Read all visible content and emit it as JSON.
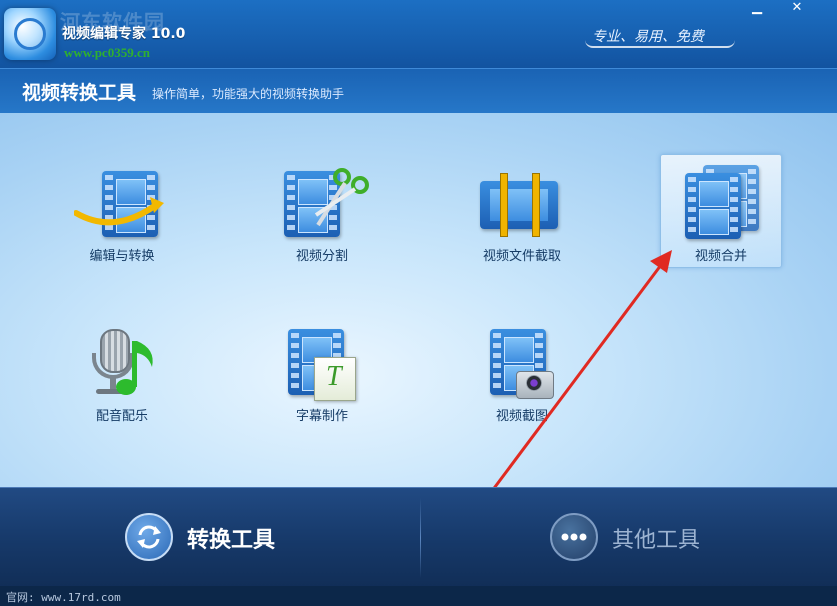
{
  "window": {
    "title": "视频编辑专家 10.0",
    "slogan": "专业、易用、免费",
    "minimize_glyph": "▁",
    "close_glyph": "✕",
    "watermark_site": "河东软件园",
    "watermark_url": "www.pc0359.cn"
  },
  "header": {
    "section_title": "视频转换工具",
    "section_desc": "操作简单，功能强大的视频转换助手"
  },
  "tools": [
    {
      "label": "编辑与转换",
      "icon": "film-edit-convert-icon"
    },
    {
      "label": "视频分割",
      "icon": "film-scissors-icon"
    },
    {
      "label": "视频文件截取",
      "icon": "film-trim-icon"
    },
    {
      "label": "视频合并",
      "icon": "film-merge-icon",
      "selected": true
    },
    {
      "label": "配音配乐",
      "icon": "microphone-music-icon"
    },
    {
      "label": "字幕制作",
      "icon": "film-subtitle-icon"
    },
    {
      "label": "视频截图",
      "icon": "film-camera-icon"
    }
  ],
  "bottom_tabs": {
    "convert_label": "转换工具",
    "other_label": "其他工具"
  },
  "status": {
    "text": "官网: www.17rd.com"
  },
  "colors": {
    "accent_blue": "#1c6fc3",
    "annotation_arrow": "#e02a22"
  }
}
